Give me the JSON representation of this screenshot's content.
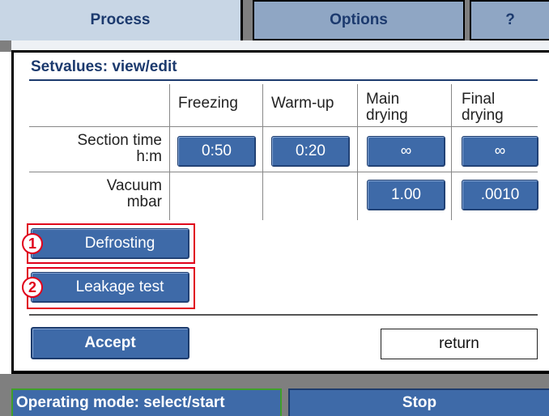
{
  "tabs": {
    "process": "Process",
    "options": "Options",
    "help": "?"
  },
  "dialog": {
    "title": "Setvalues: view/edit",
    "columns": {
      "freezing": "Freezing",
      "warmup": "Warm-up",
      "main_drying": [
        "Main",
        "drying"
      ],
      "final_drying": [
        "Final",
        "drying"
      ]
    },
    "rows": {
      "section_time_label": [
        "Section time",
        "h:m"
      ],
      "vacuum_label": [
        "Vacuum",
        "mbar"
      ]
    },
    "values": {
      "section_time": {
        "freezing": "0:50",
        "warmup": "0:20",
        "main_drying": "∞",
        "final_drying": "∞"
      },
      "vacuum": {
        "main_drying": "1.00",
        "final_drying": ".0010"
      }
    },
    "side_buttons": {
      "defrosting": {
        "marker": "1",
        "label": "Defrosting"
      },
      "leakage_test": {
        "marker": "2",
        "label": "Leakage test"
      }
    },
    "accept_label": "Accept",
    "return_label": "return"
  },
  "status_bar": {
    "operating_mode": "Operating mode: select/start",
    "stop": "Stop"
  },
  "colors": {
    "button_blue": "#3e6aa8",
    "title_blue": "#1c3a6e",
    "highlight_red": "#e0001b",
    "active_green": "#3fa02a"
  }
}
